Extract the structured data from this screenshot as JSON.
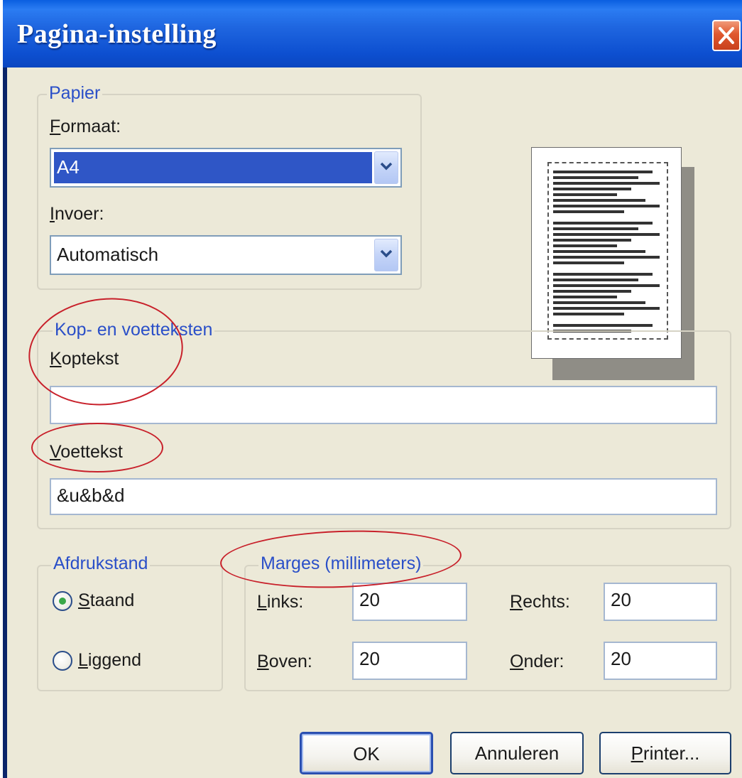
{
  "window": {
    "title": "Pagina-instelling"
  },
  "paper": {
    "legend": "Papier",
    "format_label_u": "F",
    "format_label_rest": "ormaat:",
    "format_value": "A4",
    "feed_label_u": "I",
    "feed_label_rest": "nvoer:",
    "feed_value": "Automatisch"
  },
  "headers_footers": {
    "legend": "Kop- en voetteksten",
    "header_label_u": "K",
    "header_label_rest": "optekst",
    "header_value": "",
    "footer_label_u": "V",
    "footer_label_rest": "oettekst",
    "footer_value": "&u&b&d"
  },
  "orientation": {
    "legend": "Afdrukstand",
    "portrait_u": "S",
    "portrait_rest": "taand",
    "landscape_u": "L",
    "landscape_rest": "iggend",
    "selected": "Staand"
  },
  "margins": {
    "legend": "Marges (millimeters)",
    "left_u": "L",
    "left_rest": "inks:",
    "left_value": "20",
    "right_u": "R",
    "right_rest": "echts:",
    "right_value": "20",
    "top_u": "B",
    "top_rest": "oven:",
    "top_value": "20",
    "bottom_u": "O",
    "bottom_rest": "nder:",
    "bottom_value": "20"
  },
  "buttons": {
    "ok": "OK",
    "cancel": "Annuleren",
    "printer_u": "P",
    "printer_rest": "rinter..."
  },
  "colors": {
    "title_bar": "#1f66e0",
    "legend_text": "#2a4fc8",
    "dialog_bg": "#ece9d8",
    "annotation_red": "#c8202a"
  }
}
